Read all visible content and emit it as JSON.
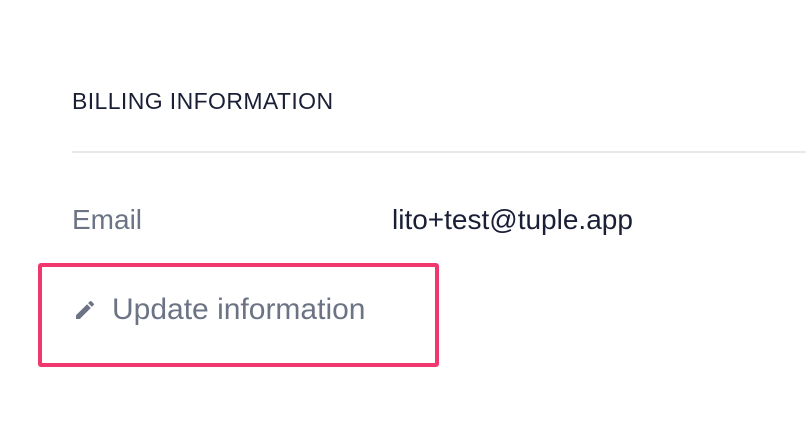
{
  "billing": {
    "section_title": "BILLING INFORMATION",
    "email_label": "Email",
    "email_value": "lito+test@tuple.app",
    "update_label": "Update information",
    "update_icon": "pencil-icon"
  },
  "colors": {
    "heading_text": "#1a1f36",
    "muted_text": "#6b7385",
    "divider": "#e6e8ec",
    "highlight_border": "#f0386e"
  }
}
